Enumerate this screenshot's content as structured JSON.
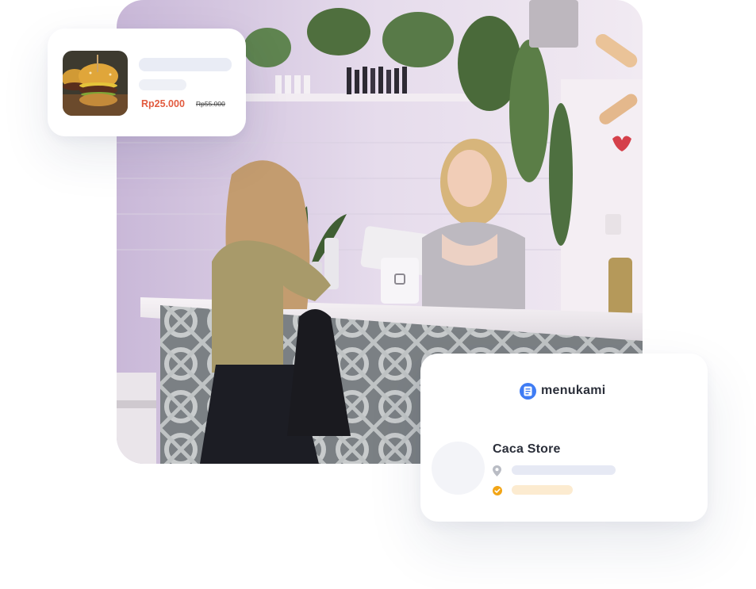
{
  "product_card": {
    "image_icon": "burger-photo",
    "price": "Rp25.000",
    "old_price": "Rp55.000"
  },
  "store_card": {
    "brand_icon": "menu-book-icon",
    "brand_name": "menukami",
    "store_name": "Caca Store",
    "location_icon": "location-pin-icon",
    "verified_icon": "check-badge-icon"
  },
  "hero": {
    "image": "cafe-counter-photo"
  },
  "colors": {
    "price": "#e25b3f",
    "brand": "#3f7cf4",
    "verified": "#f2a516",
    "skeleton": "#e9ecf5",
    "skeleton_accent": "#fcebd0"
  }
}
